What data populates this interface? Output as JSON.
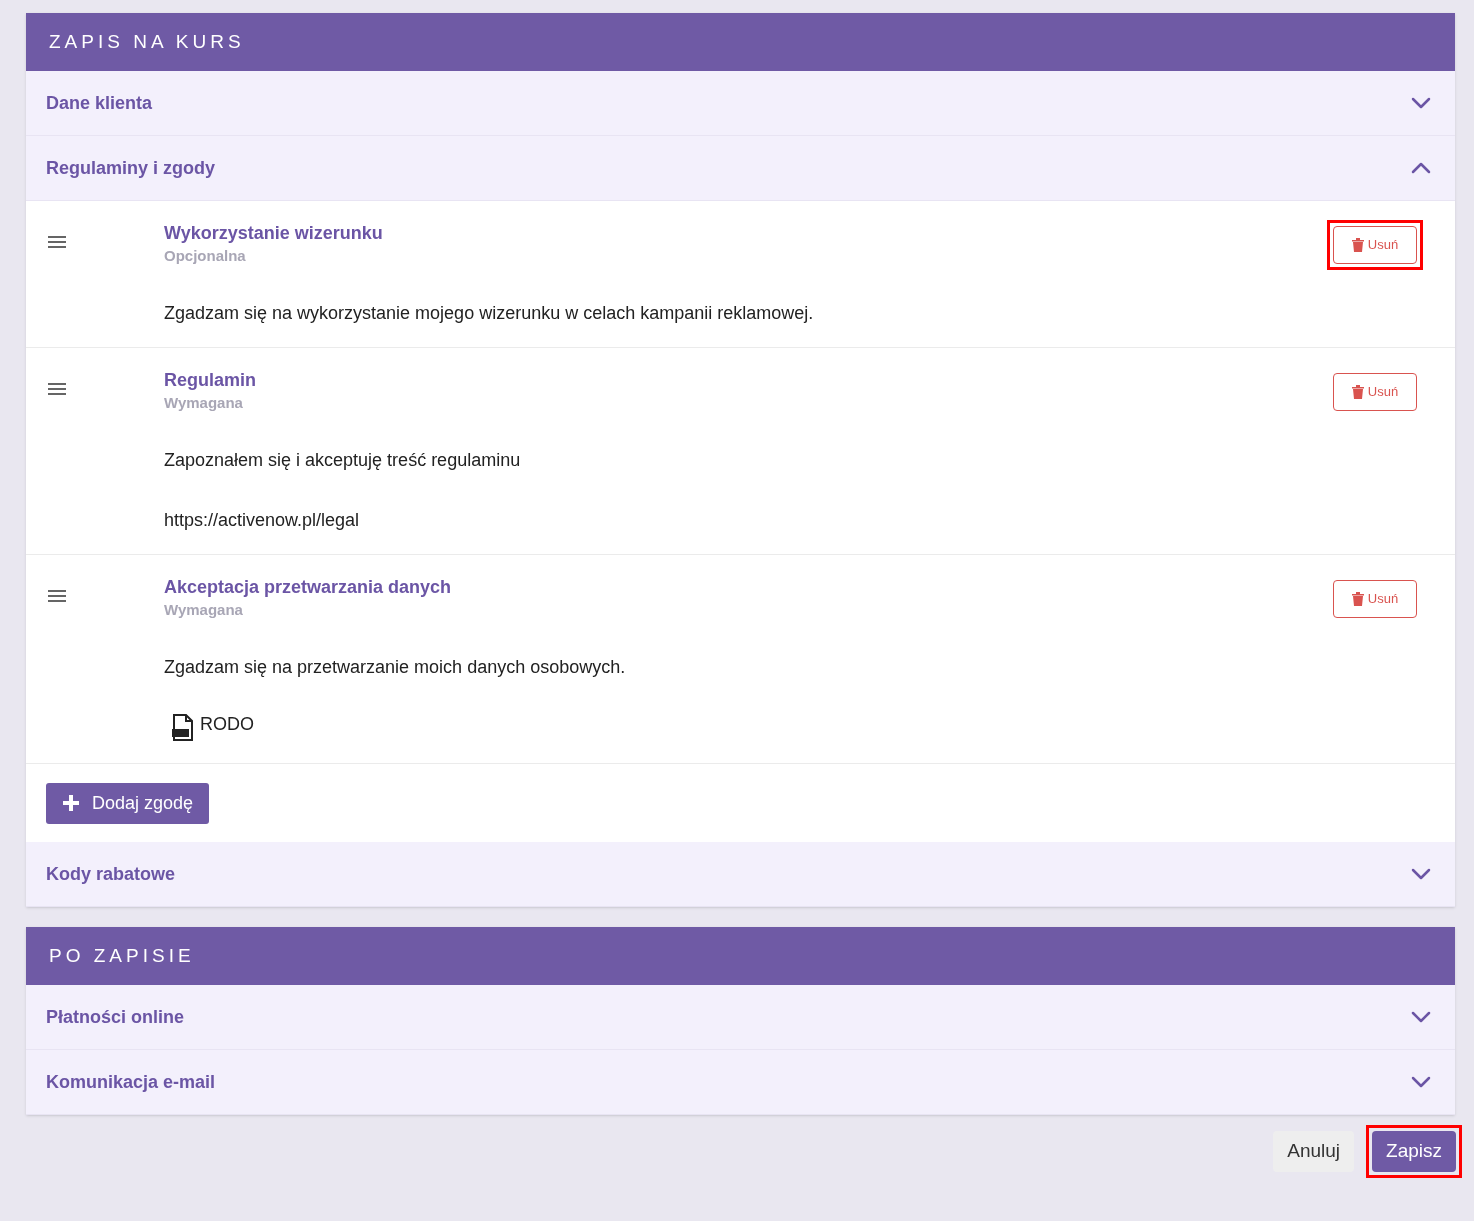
{
  "sections": [
    {
      "title": "ZAPIS NA KURS",
      "panels": [
        {
          "title": "Dane klienta",
          "expanded": false
        },
        {
          "title": "Regulaminy i zgody",
          "expanded": true,
          "consents": [
            {
              "title": "Wykorzystanie wizerunku",
              "requirement": "Opcjonalna",
              "delete_label": "Usuń",
              "highlighted": true,
              "body": [
                {
                  "kind": "text",
                  "text": "Zgadzam się na wykorzystanie mojego wizerunku w celach kampanii reklamowej."
                }
              ]
            },
            {
              "title": "Regulamin",
              "requirement": "Wymagana",
              "delete_label": "Usuń",
              "highlighted": false,
              "body": [
                {
                  "kind": "text",
                  "text": "Zapoznałem się i akceptuję treść regulaminu"
                },
                {
                  "kind": "text",
                  "text": "https://activenow.pl/legal"
                }
              ]
            },
            {
              "title": "Akceptacja przetwarzania danych",
              "requirement": "Wymagana",
              "delete_label": "Usuń",
              "highlighted": false,
              "body": [
                {
                  "kind": "text",
                  "text": "Zgadzam się na przetwarzanie moich danych osobowych."
                },
                {
                  "kind": "file",
                  "text": "RODO"
                }
              ]
            }
          ],
          "add_label": "Dodaj zgodę"
        },
        {
          "title": "Kody rabatowe",
          "expanded": false
        }
      ]
    },
    {
      "title": "PO ZAPISIE",
      "panels": [
        {
          "title": "Płatności online",
          "expanded": false
        },
        {
          "title": "Komunikacja e-mail",
          "expanded": false
        }
      ]
    }
  ],
  "footer": [
    {
      "label": "Anuluj",
      "kind": "secondary",
      "highlighted": false
    },
    {
      "label": "Zapisz",
      "kind": "primary",
      "highlighted": true
    }
  ]
}
